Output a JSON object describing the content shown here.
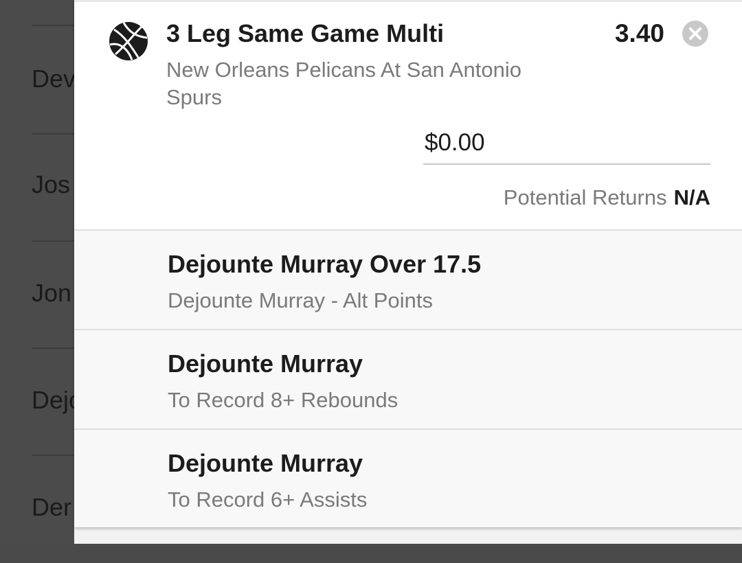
{
  "background_list": {
    "items": [
      {
        "label": "Dev"
      },
      {
        "label": "Jos"
      },
      {
        "label": "Jon"
      },
      {
        "label": "Dejo"
      },
      {
        "label": "Der"
      }
    ]
  },
  "bet_slip": {
    "icon": "basketball-icon",
    "title": "3 Leg Same Game Multi",
    "odds": "3.40",
    "close_icon": "close-icon",
    "event": "New Orleans Pelicans At San Antonio Spurs",
    "stake_value": "$0.00",
    "returns_label": "Potential Returns",
    "returns_value": "N/A",
    "legs": [
      {
        "title": "Dejounte Murray Over 17.5",
        "subtitle": "Dejounte Murray - Alt Points"
      },
      {
        "title": "Dejounte Murray",
        "subtitle": "To Record 8+ Rebounds"
      },
      {
        "title": "Dejounte Murray",
        "subtitle": "To Record 6+ Assists"
      }
    ]
  },
  "colors": {
    "overlay": "#4b4b4b",
    "text_primary": "#1c1c1c",
    "text_secondary": "#7a7a7a",
    "leg_background": "#f8f8f8",
    "close_icon": "#c8c8c8"
  }
}
